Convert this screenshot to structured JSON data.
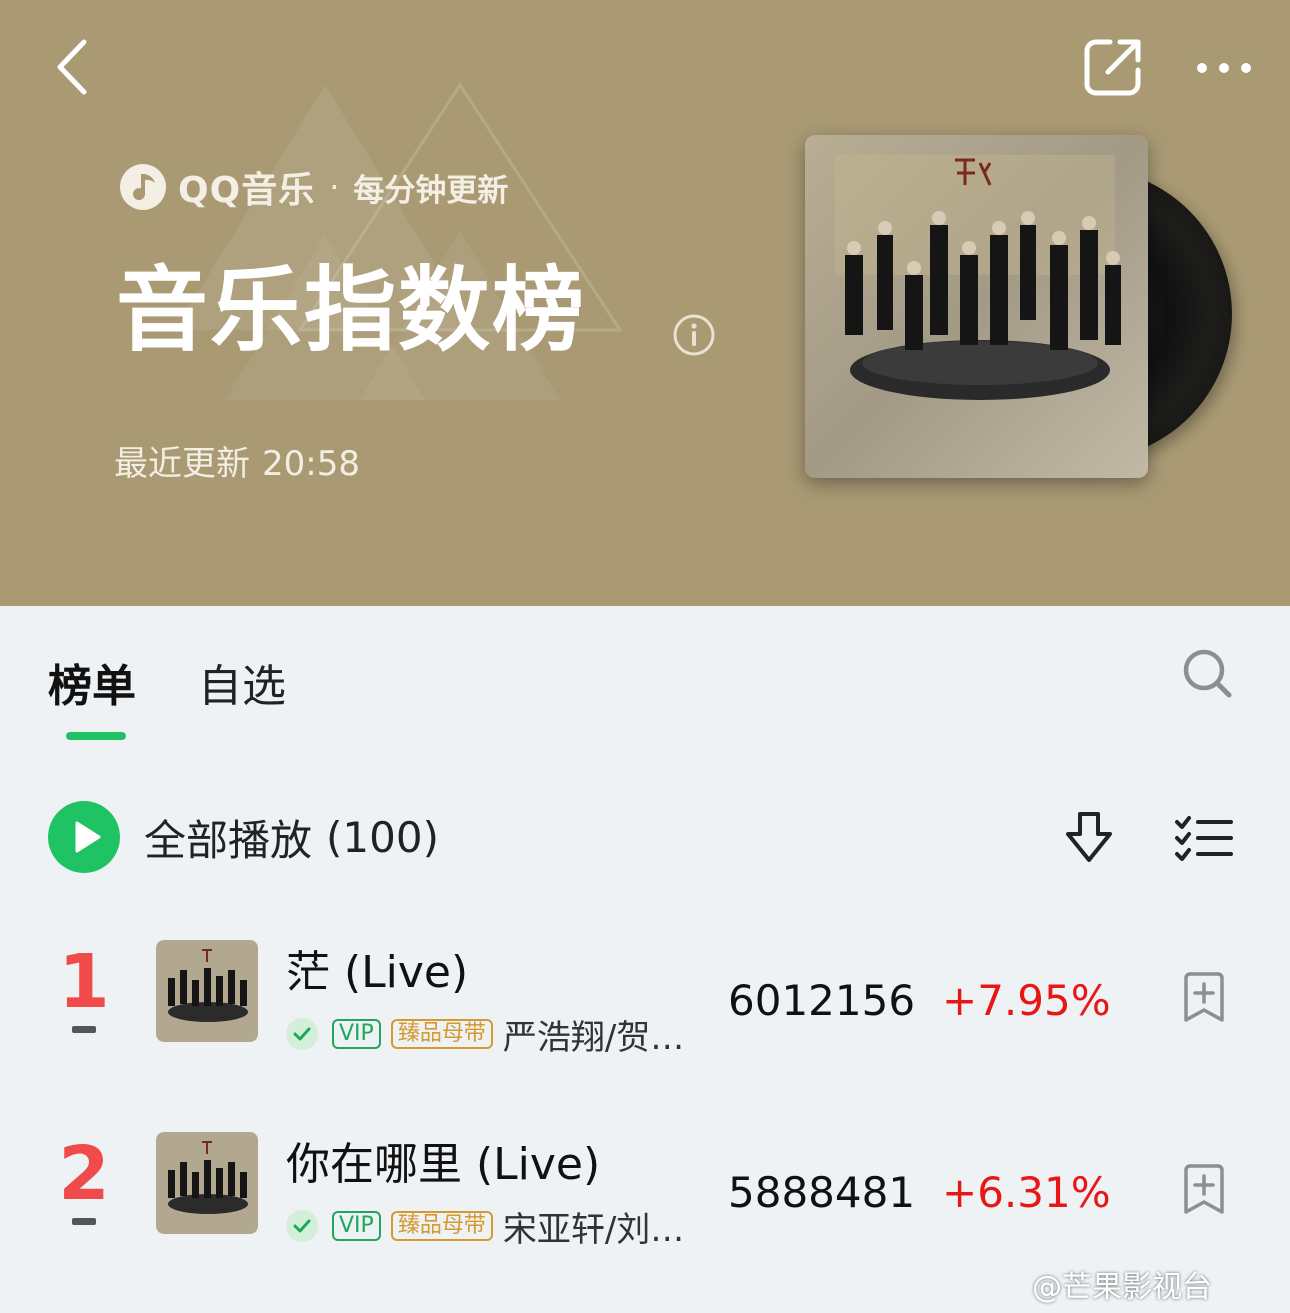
{
  "header": {
    "brand": "QQ音乐",
    "dot": "·",
    "tagline": "每分钟更新",
    "title": "音乐指数榜",
    "updated_label": "最近更新",
    "updated_time": "20:58",
    "background_color": "#a99a74"
  },
  "tabs": [
    {
      "label": "榜单",
      "active": true
    },
    {
      "label": "自选",
      "active": false
    }
  ],
  "accent_color": "#1fc363",
  "play_all": {
    "label": "全部播放",
    "count": "(100)"
  },
  "songs": [
    {
      "rank": "1",
      "title": "茫 (Live)",
      "vip": "VIP",
      "quality": "臻品母带",
      "artist": "严浩翔/贺峻霖/刘耀文/宋亚轩/丁程鑫/马嘉祺/张真源",
      "score": "6012156",
      "change": "+7.95%"
    },
    {
      "rank": "2",
      "title": "你在哪里 (Live)",
      "vip": "VIP",
      "quality": "臻品母带",
      "artist": "宋亚轩/刘耀文/严浩翔/贺峻霖/丁程鑫/马嘉祺/张真源",
      "score": "5888481",
      "change": "+6.31%"
    }
  ],
  "icons": {
    "back": "chevron-left-icon",
    "share": "share-icon",
    "more": "more-icon",
    "info": "info-icon",
    "search": "search-icon",
    "play": "play-icon",
    "download": "download-icon",
    "multiselect": "multiselect-list-icon",
    "add": "add-to-playlist-icon"
  },
  "watermark": "@芒果影视台"
}
